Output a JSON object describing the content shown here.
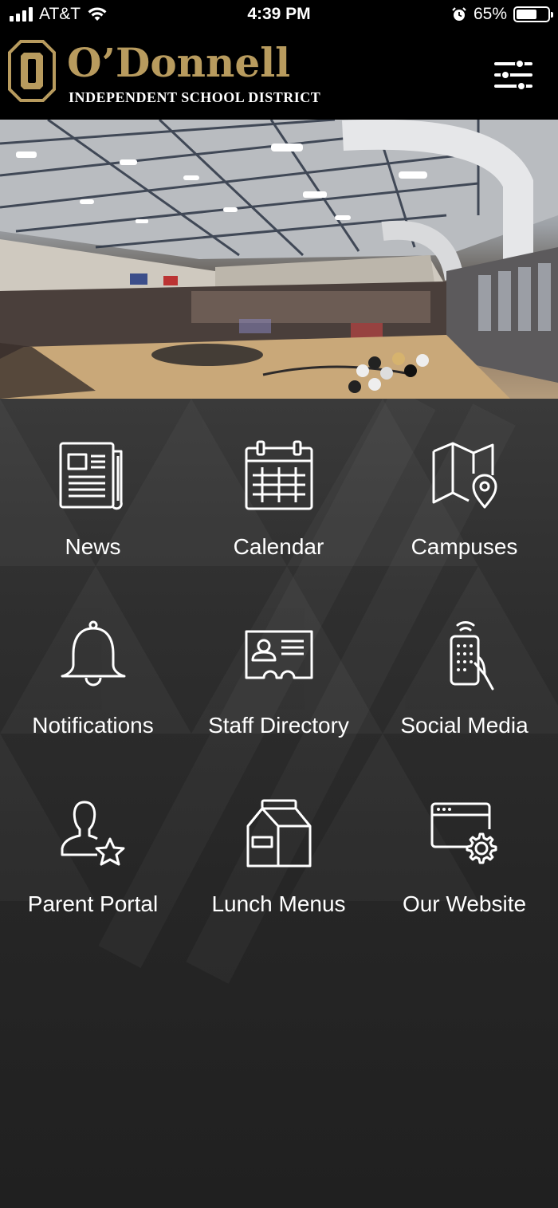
{
  "status_bar": {
    "carrier": "AT&T",
    "time": "4:39 PM",
    "battery_percent": "65%",
    "battery_level": 0.65,
    "icons": [
      "signal-icon",
      "wifi-icon",
      "alarm-icon",
      "battery-icon"
    ]
  },
  "header": {
    "title": "O’Donnell",
    "subtitle": "INDEPENDENT SCHOOL DISTRICT",
    "menu_icon": "sliders-icon",
    "colors": {
      "brand_gold": "#b89b5e",
      "background": "#000000"
    }
  },
  "hero": {
    "image": "gymnasium-photo"
  },
  "grid": {
    "items": [
      {
        "label": "News",
        "icon": "newspaper-icon"
      },
      {
        "label": "Calendar",
        "icon": "calendar-icon"
      },
      {
        "label": "Campuses",
        "icon": "map-pin-icon"
      },
      {
        "label": "Notifications",
        "icon": "bell-icon"
      },
      {
        "label": "Staff Directory",
        "icon": "id-card-icon"
      },
      {
        "label": "Social Media",
        "icon": "phone-hand-icon"
      },
      {
        "label": "Parent Portal",
        "icon": "user-star-icon"
      },
      {
        "label": "Lunch Menus",
        "icon": "milk-carton-icon"
      },
      {
        "label": "Our Website",
        "icon": "browser-gear-icon"
      }
    ]
  }
}
